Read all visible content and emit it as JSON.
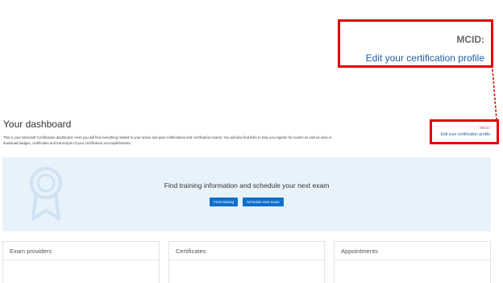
{
  "callout": {
    "mcid_label": "MCID:",
    "edit_link": "Edit your certification profile"
  },
  "profile_box": {
    "mcid_label": "MCID:",
    "edit_link": "Edit your certification profile"
  },
  "dashboard": {
    "title": "Your dashboard",
    "description": "This is your Microsoft Certification dashboard. Here you will find everything related to your active and past certifications and certification exams. You will also find links to help you register for exams as well as view or download badges, certificates and transcripts of your certification accomplishments."
  },
  "banner": {
    "title": "Find training information and schedule your next exam",
    "find_training_label": "Find training",
    "schedule_exam_label": "Schedule next exam"
  },
  "cards": [
    {
      "title": "Exam providers"
    },
    {
      "title": "Certificates"
    },
    {
      "title": "Appointments"
    }
  ],
  "colors": {
    "highlight": "#e00000",
    "link": "#1e5fa8",
    "button": "#0e6fce",
    "banner_bg": "#e8f2fb"
  }
}
